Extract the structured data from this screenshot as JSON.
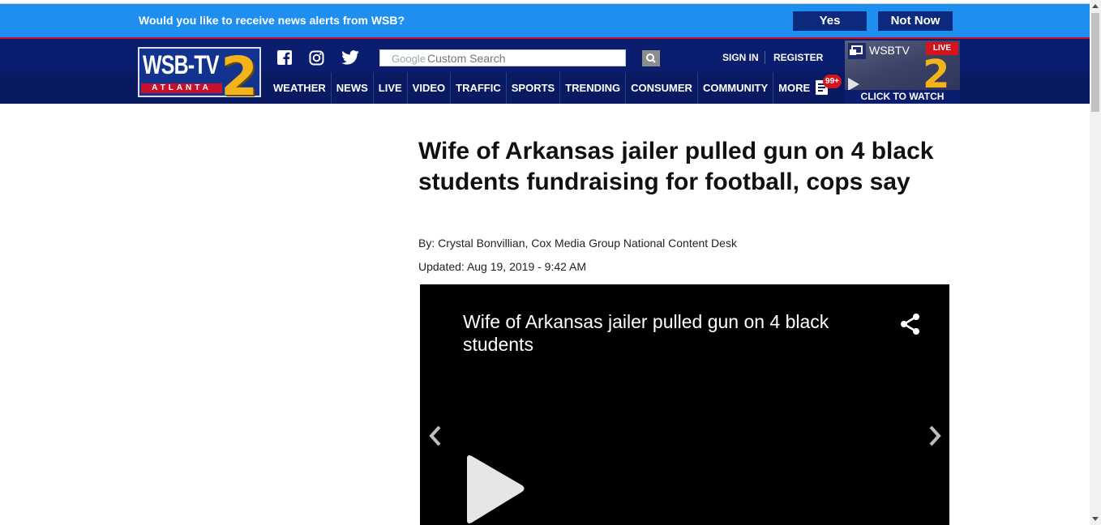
{
  "alert": {
    "question": "Would you like to receive news alerts from WSB?",
    "yes_label": "Yes",
    "no_label": "Not Now"
  },
  "brand": {
    "logo_text": "WSB-TV",
    "logo_city": "ATLANTA",
    "logo_number": "2",
    "colors": {
      "alert_blue": "#1e8ff0",
      "header_navy": "#0b1d6e",
      "accent_red": "#c8102e",
      "logo_gold": "#f2b31b"
    }
  },
  "header": {
    "social": [
      "facebook-icon",
      "instagram-icon",
      "twitter-icon"
    ],
    "search": {
      "google_label": "Google",
      "placeholder": "Custom Search"
    },
    "sign_in": "SIGN IN",
    "register": "REGISTER",
    "notifications_badge": "99+",
    "watch": {
      "channel": "WSBTV",
      "live": "LIVE",
      "cta": "CLICK TO WATCH NEWS"
    }
  },
  "nav": {
    "items": [
      "WEATHER",
      "NEWS",
      "LIVE",
      "VIDEO",
      "TRAFFIC",
      "SPORTS",
      "TRENDING",
      "CONSUMER",
      "COMMUNITY",
      "MORE"
    ]
  },
  "article": {
    "headline": "Wife of Arkansas jailer pulled gun on 4 black students fundraising for football, cops say",
    "byline": "By: Crystal Bonvillian, Cox Media Group National Content Desk",
    "updated": "Updated: Aug 19, 2019 - 9:42 AM",
    "video": {
      "title": "Wife of Arkansas jailer pulled gun on 4 black students"
    }
  }
}
